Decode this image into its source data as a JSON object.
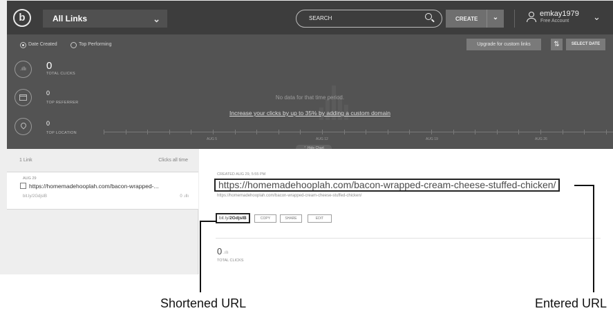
{
  "header": {
    "links_dropdown": "All Links",
    "search_placeholder": "SEARCH",
    "create_label": "CREATE",
    "user": {
      "name": "emkay1979",
      "plan": "Free Account"
    }
  },
  "analytics": {
    "sort_options": [
      "Date Created",
      "Top Performing"
    ],
    "upgrade_label": "Upgrade for custom links",
    "select_date_label": "SELECT DATE",
    "stats": [
      {
        "value": "0",
        "label": "TOTAL CLICKS",
        "icon": "bar-chart-icon"
      },
      {
        "value": "0",
        "label": "TOP REFERRER",
        "icon": "browser-window-icon"
      },
      {
        "value": "0",
        "label": "TOP LOCATION",
        "icon": "location-pin-icon"
      }
    ],
    "no_data": "No data for that time period.",
    "cta_link": "Increase your clicks by up to 35% by adding a custom domain",
    "axis_labels": [
      "AUG 5",
      "AUG 12",
      "AUG 19",
      "AUG 26"
    ],
    "hide_chart_label": "⌃ Hide Chart"
  },
  "list": {
    "count_label": "1 Link",
    "clicks_label": "Clicks all time",
    "items": [
      {
        "date": "AUG 29",
        "title": "https://homemadehooplah.com/bacon-wrapped-...",
        "short": "bit.ly/2GdjslB",
        "clicks": "0"
      }
    ]
  },
  "detail": {
    "created": "CREATED AUG 29, 5:55 PM",
    "entered_url": "https://homemadehooplah.com/bacon-wrapped-cream-cheese-stuffed-chicken/",
    "long_url": "https://homemadehooplah.com/bacon-wrapped-cream-cheese-stuffed-chicken/",
    "short_prefix": "bit.ly/",
    "short_code": "2GdjslB",
    "actions": [
      "COPY",
      "SHARE",
      "EDIT"
    ],
    "total_clicks_value": "0",
    "total_clicks_label": "TOTAL CLICKS"
  },
  "callouts": {
    "shortened": "Shortened URL",
    "entered": "Entered URL"
  }
}
